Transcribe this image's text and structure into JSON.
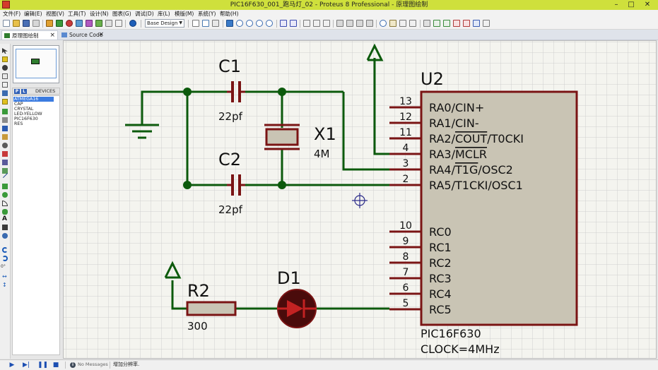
{
  "window": {
    "title": "PIC16F630_001_跑马灯_02 - Proteus 8 Professional - 原理图绘制",
    "minimize": "–",
    "maximize": "□",
    "close": "✕"
  },
  "menu": [
    "文件(F)",
    "编辑(E)",
    "视图(V)",
    "工具(T)",
    "设计(N)",
    "图表(G)",
    "调试(D)",
    "库(L)",
    "模版(M)",
    "系统(Y)",
    "帮助(H)"
  ],
  "toolbar": {
    "design_select": "Base Design"
  },
  "tabs": [
    {
      "label": "原理图绘制",
      "active": true
    },
    {
      "label": "Source Code",
      "active": false
    }
  ],
  "devices": {
    "p_button": "P",
    "l_button": "L",
    "header": "DEVICES",
    "items": [
      "ATMEGA16",
      "CAP",
      "CRYSTAL",
      "LED-YELLOW",
      "PIC16F630",
      "RES"
    ],
    "selected_index": 0
  },
  "left_toolbar": {
    "rotation": "0°"
  },
  "schematic": {
    "c1": {
      "ref": "C1",
      "value": "22pf"
    },
    "c2": {
      "ref": "C2",
      "value": "22pf"
    },
    "x1": {
      "ref": "X1",
      "value": "4M"
    },
    "r2": {
      "ref": "R2",
      "value": "300"
    },
    "d1": {
      "ref": "D1"
    },
    "u2": {
      "ref": "U2",
      "part": "PIC16F630",
      "clock": "CLOCK=4MHz",
      "pins_top": [
        {
          "num": "13",
          "label": "RA0/CIN+"
        },
        {
          "num": "12",
          "label": "RA1/CIN-"
        },
        {
          "num": "11",
          "label": "RA2/COUT/T0CKI"
        },
        {
          "num": "4",
          "label": "RA3/MCLR"
        },
        {
          "num": "3",
          "label": "RA4/T1G/OSC2"
        },
        {
          "num": "2",
          "label": "RA5/T1CKI/OSC1"
        }
      ],
      "pins_bottom": [
        {
          "num": "10",
          "label": "RC0"
        },
        {
          "num": "9",
          "label": "RC1"
        },
        {
          "num": "8",
          "label": "RC2"
        },
        {
          "num": "7",
          "label": "RC3"
        },
        {
          "num": "6",
          "label": "RC4"
        },
        {
          "num": "5",
          "label": "RC5"
        }
      ]
    },
    "colors": {
      "wire": "#0c5a0c",
      "component": "#7a1414",
      "body": "#c9c4b4",
      "grid": "#cfcfcf",
      "sheet": "#f4f4ef"
    }
  },
  "status": {
    "messages": "No Messages",
    "text": "增加分辨率."
  }
}
